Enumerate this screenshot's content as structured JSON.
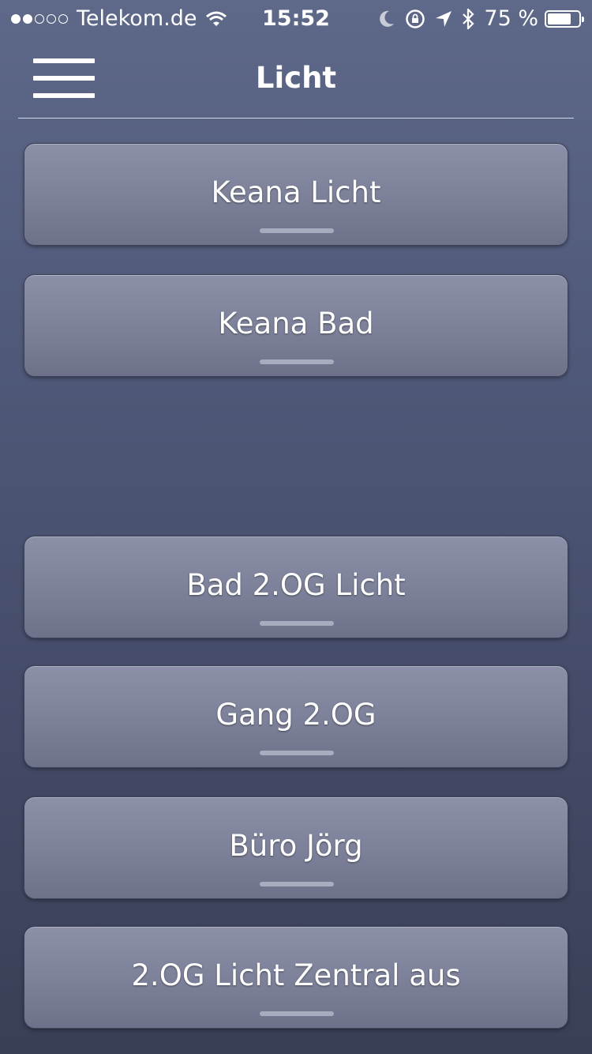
{
  "status_bar": {
    "carrier": "Telekom.de",
    "time": "15:52",
    "battery_percent": "75 %",
    "battery_level": 0.75,
    "icons": [
      "signal-dots-icon",
      "wifi-icon",
      "moon-icon",
      "rotation-lock-icon",
      "location-arrow-icon",
      "bluetooth-icon",
      "battery-icon"
    ]
  },
  "nav": {
    "title": "Licht",
    "menu_icon": "hamburger-menu-icon"
  },
  "buttons": [
    {
      "label": "Keana Licht"
    },
    {
      "label": "Keana Bad"
    },
    {
      "label": "Bad 2.OG Licht"
    },
    {
      "label": "Gang 2.OG"
    },
    {
      "label": "Büro Jörg"
    },
    {
      "label": "2.OG Licht Zentral aus"
    }
  ],
  "colors": {
    "background_top": "#5e6889",
    "background_bottom": "#393f56",
    "button_face": "#7d829a",
    "text": "#ffffff"
  }
}
